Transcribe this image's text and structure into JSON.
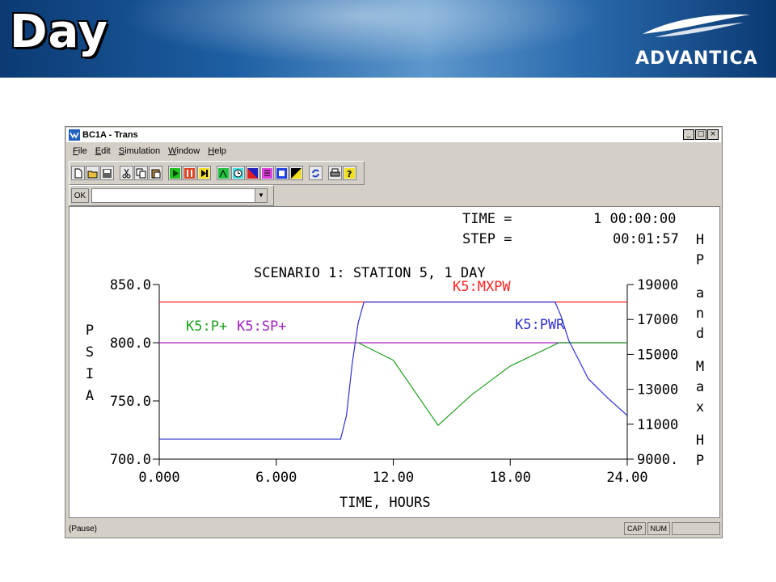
{
  "slide": {
    "title": "Day",
    "logo_text": "ADVANTICA"
  },
  "window": {
    "title": "BC1A - Trans",
    "controls": {
      "minimize": "_",
      "maximize": "□",
      "close": "×"
    }
  },
  "menu": [
    {
      "label": "File",
      "accel": "F",
      "rest": "ile"
    },
    {
      "label": "Edit",
      "accel": "E",
      "rest": "dit"
    },
    {
      "label": "Simulation",
      "accel": "S",
      "rest": "imulation"
    },
    {
      "label": "Window",
      "accel": "W",
      "rest": "indow"
    },
    {
      "label": "Help",
      "accel": "H",
      "rest": "elp"
    }
  ],
  "toolbar_icons": [
    [
      "new-file-icon",
      "open-folder-icon",
      "save-icon"
    ],
    [
      "cut-icon",
      "copy-icon",
      "paste-icon"
    ],
    [
      "play-icon",
      "pause-icon",
      "step-icon"
    ],
    [
      "graph-icon",
      "clock-icon",
      "color-icon",
      "list-icon",
      "window-icon",
      "chart-icon"
    ],
    [
      "refresh-icon"
    ],
    [
      "print-icon",
      "help-icon"
    ]
  ],
  "command": {
    "ok_label": "OK",
    "value": ""
  },
  "plot_text": {
    "time_label": "TIME =",
    "time_value": "1 00:00:00",
    "step_label": "STEP =",
    "step_value": "00:01:57",
    "scenario": "SCENARIO 1: STATION 5, 1 DAY"
  },
  "chart_data": {
    "type": "line",
    "title": "SCENARIO 1: STATION 5, 1 DAY",
    "xlabel": "TIME, HOURS",
    "ylabel_left": "PSIA",
    "ylabel_right": "HP and Max HP",
    "xlim": [
      0,
      24
    ],
    "ylim_left": [
      700,
      850
    ],
    "ylim_right": [
      9000,
      19000
    ],
    "x_ticks": [
      "0.000",
      "6.000",
      "12.00",
      "18.00",
      "24.00"
    ],
    "y_left_ticks": [
      "850.0",
      "800.0",
      "750.0",
      "700.0"
    ],
    "y_right_ticks": [
      "19000",
      "17000",
      "15000",
      "13000",
      "11000",
      "9000."
    ],
    "series": [
      {
        "name": "K5:MXPW",
        "axis": "right",
        "color": "#ff2020",
        "x": [
          0,
          24
        ],
        "y": [
          18000,
          18000
        ]
      },
      {
        "name": "K5:SP+",
        "axis": "left",
        "color": "#a020c0",
        "x": [
          0,
          24
        ],
        "y": [
          800,
          800
        ]
      },
      {
        "name": "K5:P+",
        "axis": "left",
        "color": "#20a020",
        "x": [
          10.2,
          12.0,
          14.3,
          16.0,
          18.0,
          20.5,
          24.0
        ],
        "y": [
          800,
          785,
          729,
          755,
          780,
          800,
          800
        ]
      },
      {
        "name": "K5:PWR",
        "axis": "right",
        "color": "#3030d0",
        "x": [
          0,
          9.3,
          9.6,
          9.9,
          10.2,
          10.5,
          20.0,
          20.3,
          20.6,
          21.0,
          22.0,
          23.0,
          24.0
        ],
        "y": [
          10150,
          10150,
          11500,
          14500,
          16800,
          18000,
          18000,
          18000,
          17200,
          15800,
          13600,
          12500,
          11500
        ]
      }
    ]
  },
  "status": {
    "text": "(Pause)",
    "cap": "CAP",
    "num": "NUM"
  }
}
